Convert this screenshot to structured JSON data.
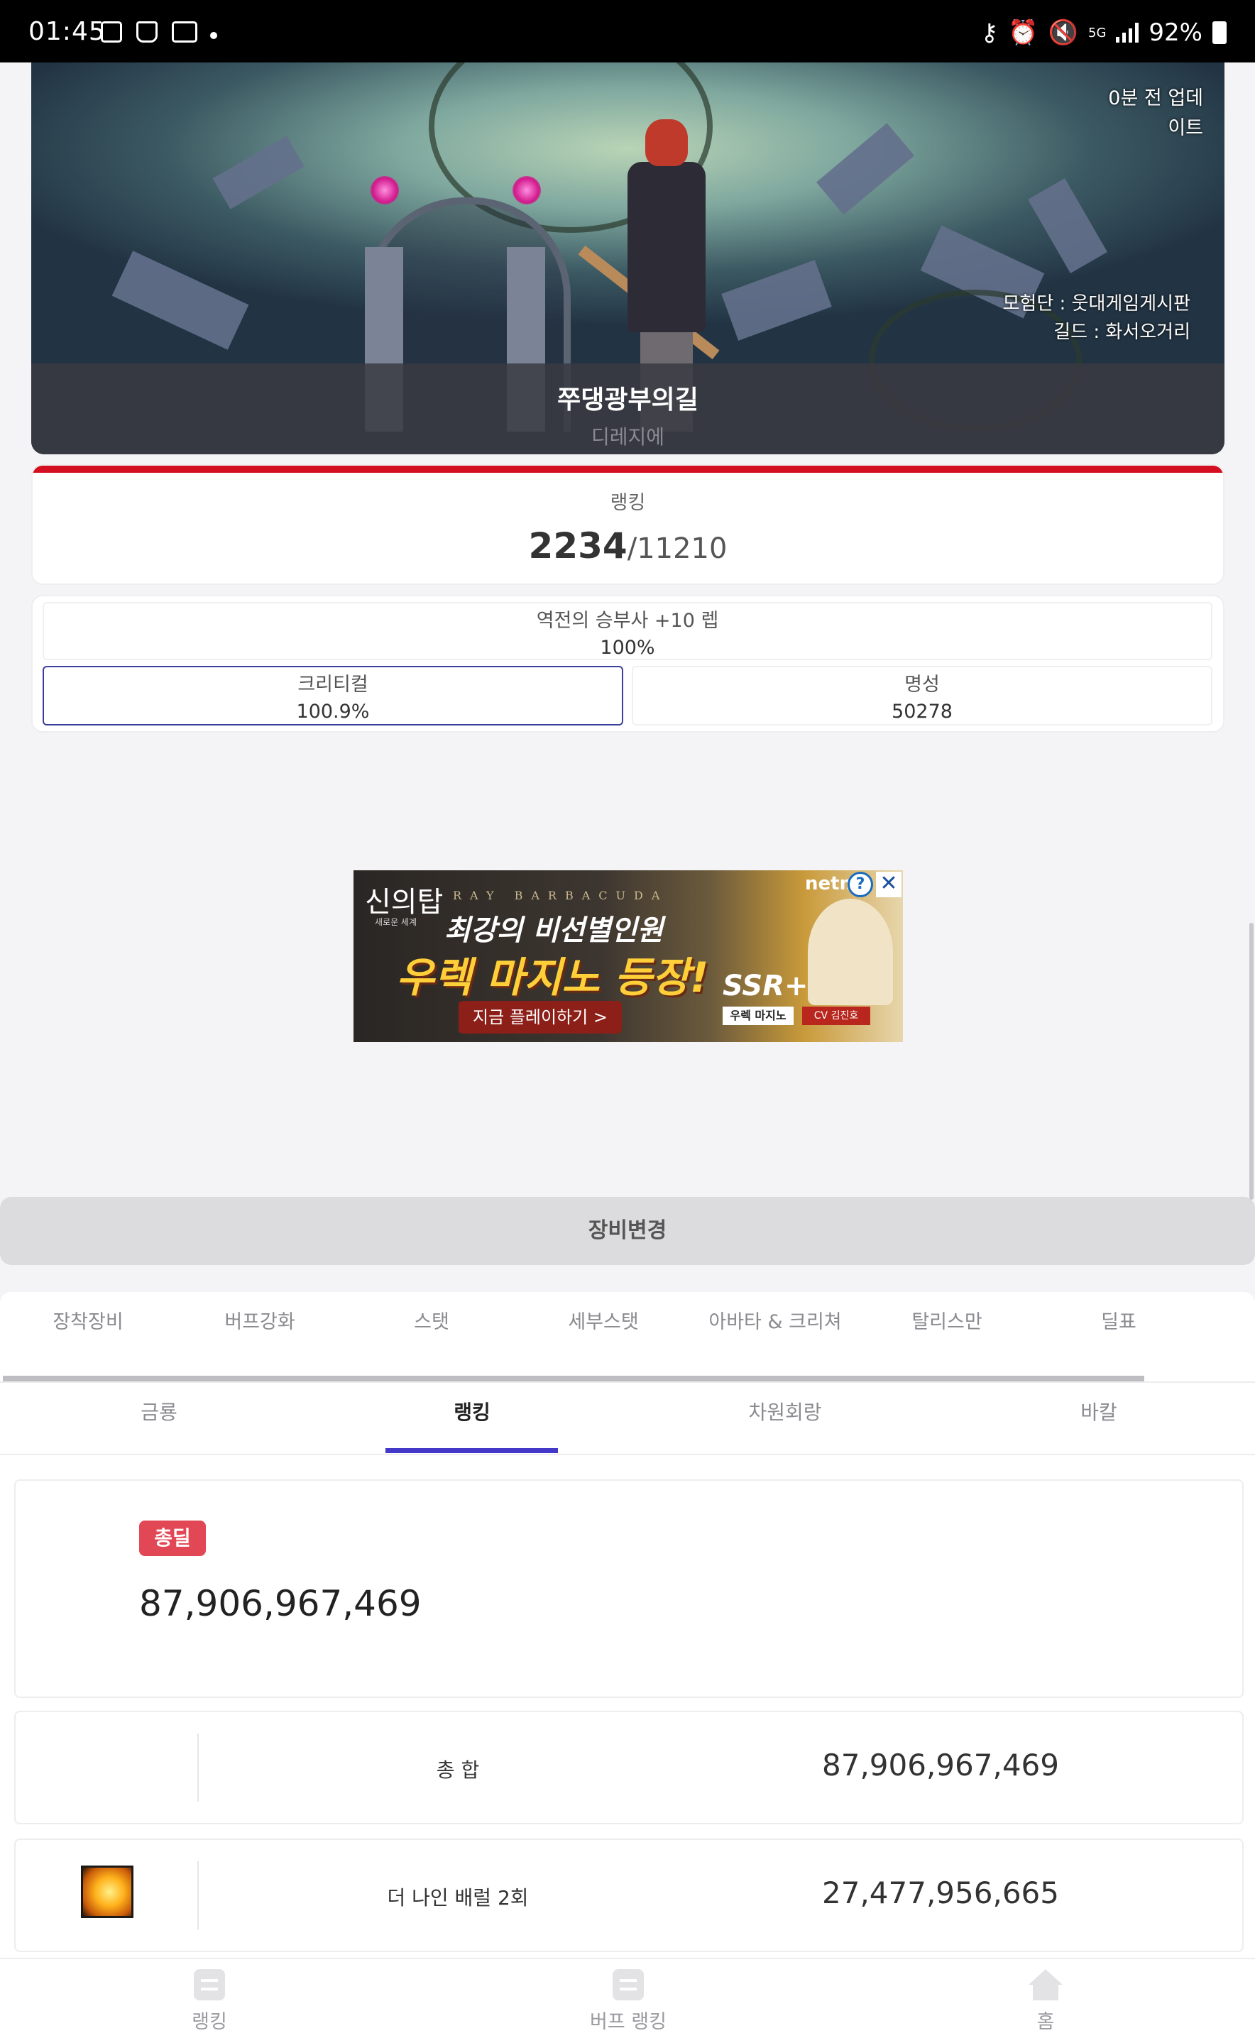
{
  "status_bar": {
    "time": "01:45",
    "battery": "92%",
    "network": "5G"
  },
  "hero": {
    "update_text": "0분 전 업데이트",
    "update_line1": "0분 전 업데",
    "update_line2": "이트",
    "adventure_group": "모험단 : 웃대게임게시판",
    "guild": "길드 : 화서오거리",
    "character_name": "쭈댕광부의길",
    "server": "디레지에"
  },
  "ranking": {
    "label": "랭킹",
    "rank": "2234",
    "total": "/11210"
  },
  "stats": {
    "title_item": {
      "label": "역전의 승부사 +10 렙",
      "value": "100%"
    },
    "critical": {
      "label": "크리티컬",
      "value": "100.9%"
    },
    "fame": {
      "label": "명성",
      "value": "50278"
    }
  },
  "ad": {
    "logo": "신의탑",
    "logo_sub": "새로운 세계",
    "eng": "RAY BARBACUDA",
    "headline1": "최강의 비선별인원",
    "headline2": "우렉 마지노 등장!",
    "cta": "지금 플레이하기 >",
    "badge": "SSR+",
    "badge_name": "우렉 마지노",
    "cv": "CV 김진호",
    "brand": "netm",
    "info_icon": "?",
    "close_icon": "✕"
  },
  "equip_change_button": "장비변경",
  "tabs_primary": [
    "장착장비",
    "버프강화",
    "스탯",
    "세부스탯",
    "아바타 & 크리쳐",
    "탈리스만",
    "딜표"
  ],
  "tabs_secondary": [
    {
      "label": "금룡",
      "active": false
    },
    {
      "label": "랭킹",
      "active": true
    },
    {
      "label": "차원회랑",
      "active": false
    },
    {
      "label": "바칼",
      "active": false
    }
  ],
  "damage": {
    "badge": "총딜",
    "total": "87,906,967,469",
    "rows": [
      {
        "name": "총 합",
        "value": "87,906,967,469",
        "icon": ""
      },
      {
        "name": "더 나인 배럴 2회",
        "value": "27,477,956,665",
        "icon": "skill-icon"
      }
    ]
  },
  "bottom_nav": [
    {
      "label": "랭킹",
      "icon": "list-icon"
    },
    {
      "label": "버프 랭킹",
      "icon": "list-icon"
    },
    {
      "label": "홈",
      "icon": "home-icon"
    }
  ],
  "colors": {
    "rank_bar": "#d40f22",
    "active_tab": "#4338c8",
    "total_badge": "#e24755"
  }
}
